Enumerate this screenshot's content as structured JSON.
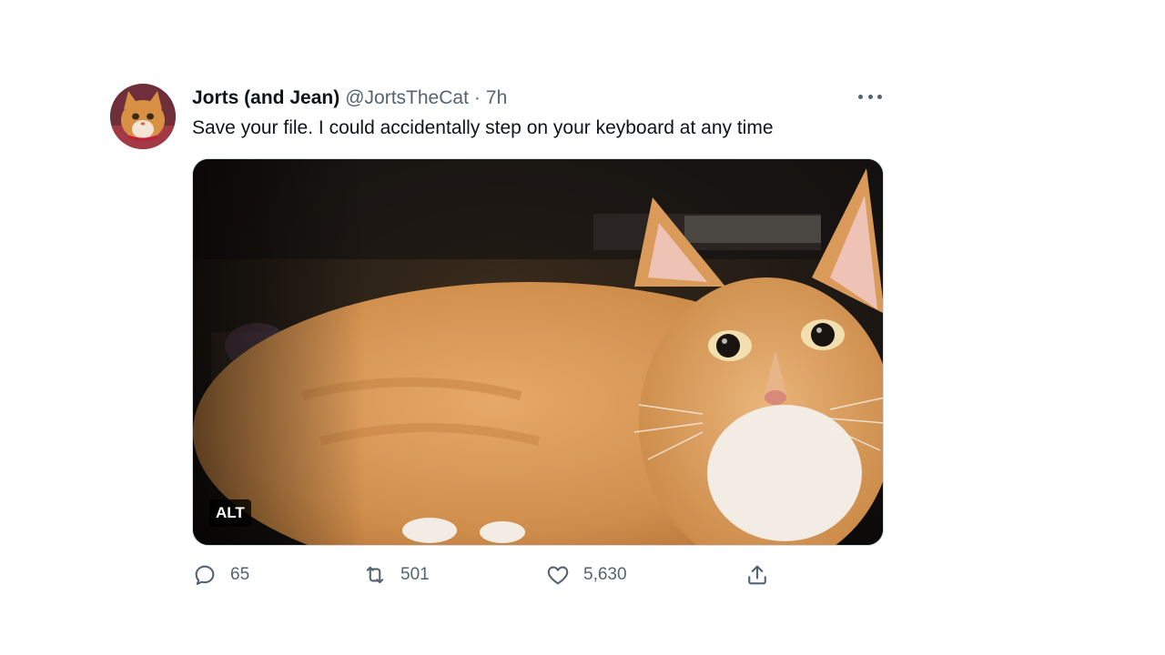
{
  "tweet": {
    "author_name": "Jorts (and Jean)",
    "handle": "@JortsTheCat",
    "separator": "·",
    "time": "7h",
    "text": "Save your file. I could accidentally step on your keyboard at any time",
    "media": {
      "alt_badge": "ALT"
    },
    "actions": {
      "replies": "65",
      "retweets": "501",
      "likes": "5,630"
    }
  },
  "icons": {
    "more": "more-options-icon",
    "reply": "reply-icon",
    "retweet": "retweet-icon",
    "like": "heart-icon",
    "share": "share-icon"
  },
  "colors": {
    "text_primary": "#0f1419",
    "text_secondary": "#536471",
    "border": "#cfd9de"
  }
}
